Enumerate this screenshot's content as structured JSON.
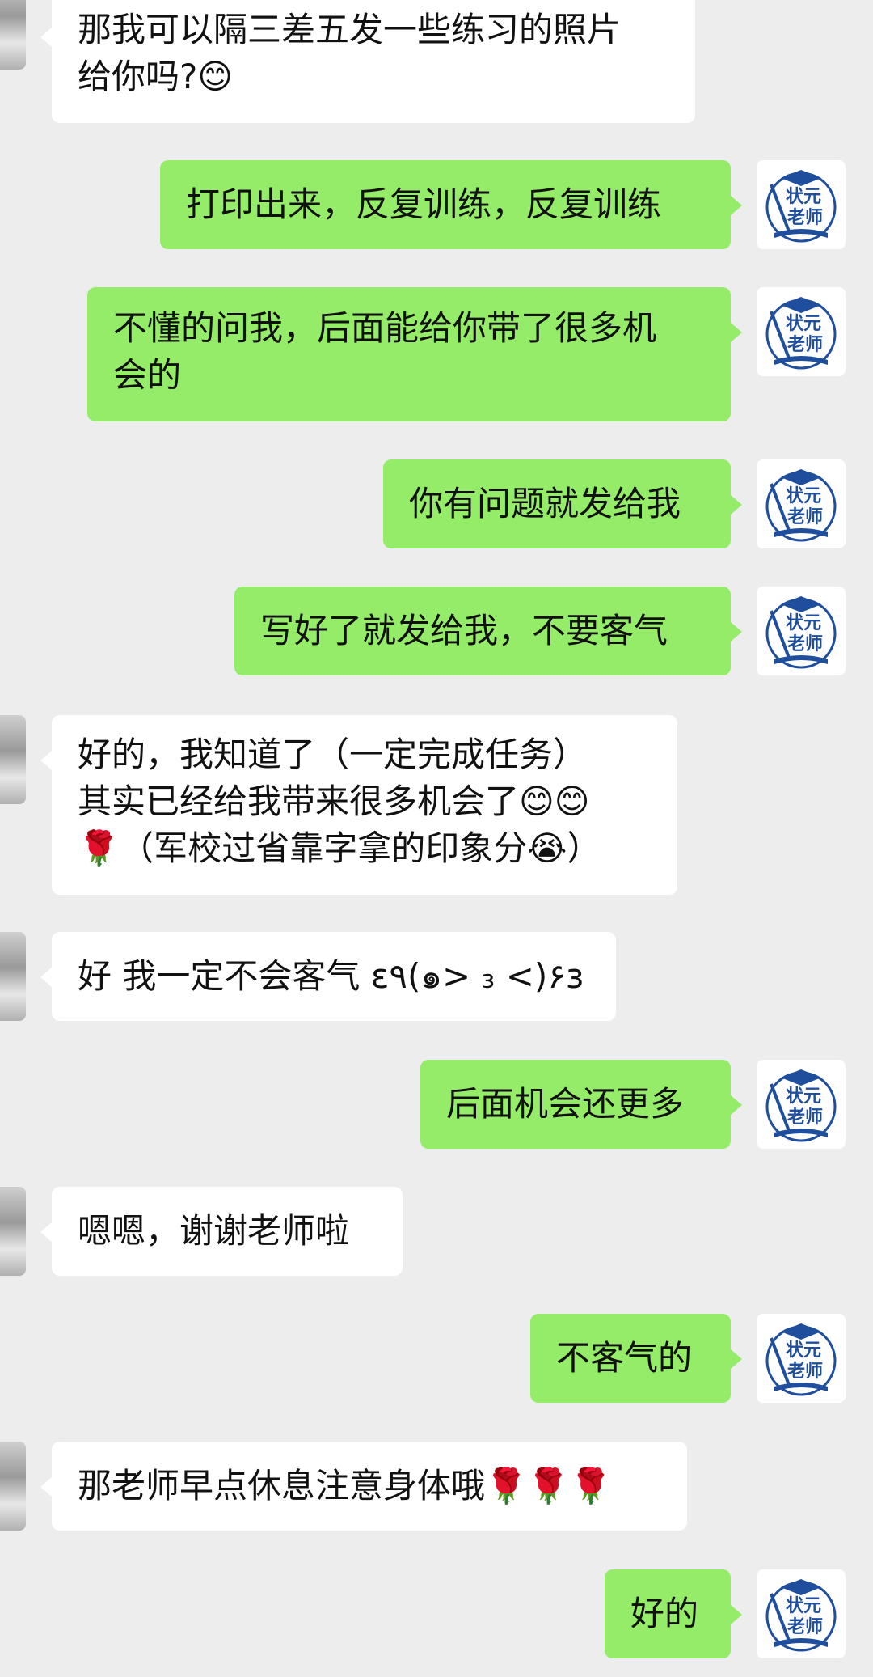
{
  "teacher_avatar": {
    "icon": "teacher-avatar-icon",
    "line1": "状元",
    "line2": "老师"
  },
  "messages": [
    {
      "side": "left",
      "text": "那我可以隔三差五发一些练习的照片\n给你吗?😊"
    },
    {
      "side": "right",
      "text": "打印出来，反复训练，反复训练"
    },
    {
      "side": "right",
      "text": "不懂的问我，后面能给你带了很多机\n会的"
    },
    {
      "side": "right",
      "text": "你有问题就发给我"
    },
    {
      "side": "right",
      "text": "写好了就发给我，不要客气"
    },
    {
      "side": "left",
      "text": "好的，我知道了（一定完成任务）\n其实已经给我带来很多机会了😊😊\n🌹（军校过省靠字拿的印象分😭）"
    },
    {
      "side": "left",
      "text": "好 我一定不会客气 ε٩(๑> ₃ <)۶з"
    },
    {
      "side": "right",
      "text": "后面机会还更多"
    },
    {
      "side": "left",
      "text": "嗯嗯，谢谢老师啦"
    },
    {
      "side": "right",
      "text": "不客气的"
    },
    {
      "side": "left",
      "text": "那老师早点休息注意身体哦🌹🌹🌹"
    },
    {
      "side": "right",
      "text": "好的"
    }
  ],
  "colors": {
    "background": "#ededed",
    "right_bubble": "#95ec69",
    "left_bubble": "#ffffff",
    "avatar_blue": "#1f4e9c"
  }
}
